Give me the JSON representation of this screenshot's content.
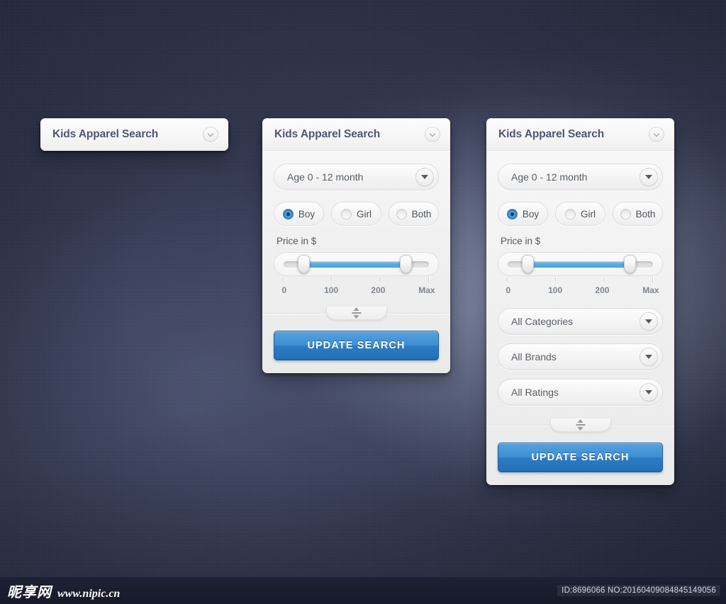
{
  "panels": {
    "collapsed": {
      "title": "Kids Apparel Search",
      "collapse_icon": "chevron-down-icon"
    },
    "mid": {
      "title": "Kids Apparel Search",
      "collapse_icon": "chevron-down-icon",
      "age_select": {
        "value": "Age 0 - 12 month",
        "arrow_icon": "triangle-down-icon"
      },
      "gender": {
        "options": [
          {
            "label": "Boy",
            "selected": true
          },
          {
            "label": "Girl",
            "selected": false
          },
          {
            "label": "Both",
            "selected": false
          }
        ]
      },
      "price": {
        "caption": "Price in $",
        "scale": [
          "0",
          "100",
          "200",
          "Max"
        ],
        "min_percent": 14,
        "max_percent": 84,
        "fill_color": "#5aa9e3"
      },
      "resize_icon": "resize-vertical-icon",
      "update_label": "UPDATE SEARCH"
    },
    "full": {
      "title": "Kids Apparel Search",
      "collapse_icon": "chevron-down-icon",
      "age_select": {
        "value": "Age 0 - 12 month",
        "arrow_icon": "triangle-down-icon"
      },
      "gender": {
        "options": [
          {
            "label": "Boy",
            "selected": true
          },
          {
            "label": "Girl",
            "selected": false
          },
          {
            "label": "Both",
            "selected": false
          }
        ]
      },
      "price": {
        "caption": "Price in $",
        "scale": [
          "0",
          "100",
          "200",
          "Max"
        ],
        "min_percent": 14,
        "max_percent": 84,
        "fill_color": "#5aa9e3"
      },
      "filters": [
        {
          "value": "All Categories",
          "arrow_icon": "triangle-down-icon"
        },
        {
          "value": "All Brands",
          "arrow_icon": "triangle-down-icon"
        },
        {
          "value": "All Ratings",
          "arrow_icon": "triangle-down-icon"
        }
      ],
      "resize_icon": "resize-vertical-icon",
      "update_label": "UPDATE SEARCH"
    }
  },
  "watermark": {
    "site_cn": "昵享网",
    "site_url": "www.nipic.cn",
    "id_text": "ID:8696066 NO:20160409084845149056"
  },
  "colors": {
    "accent_blue": "#3f8fd2",
    "slider_blue": "#5aa9e3",
    "title_text": "#4e5474",
    "background_navy": "#2b3048"
  }
}
